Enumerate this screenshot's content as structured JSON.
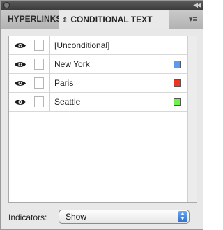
{
  "tabs": {
    "hyperlinks": "HYPERLINKS",
    "conditional_text": "CONDITIONAL TEXT"
  },
  "icons": {
    "tab_updown": "updown-arrows-icon",
    "panel_menu": "panel-menu-icon",
    "visibility": "eye-icon",
    "collapse": "double-arrow-icon"
  },
  "conditions": [
    {
      "label": "[Unconditional]",
      "swatch": null,
      "visible": true
    },
    {
      "label": "New York",
      "swatch": "#5b9bef",
      "visible": true
    },
    {
      "label": "Paris",
      "swatch": "#ee3322",
      "visible": true
    },
    {
      "label": "Seattle",
      "swatch": "#6ff04a",
      "visible": true
    }
  ],
  "indicators": {
    "label": "Indicators:",
    "value": "Show"
  }
}
